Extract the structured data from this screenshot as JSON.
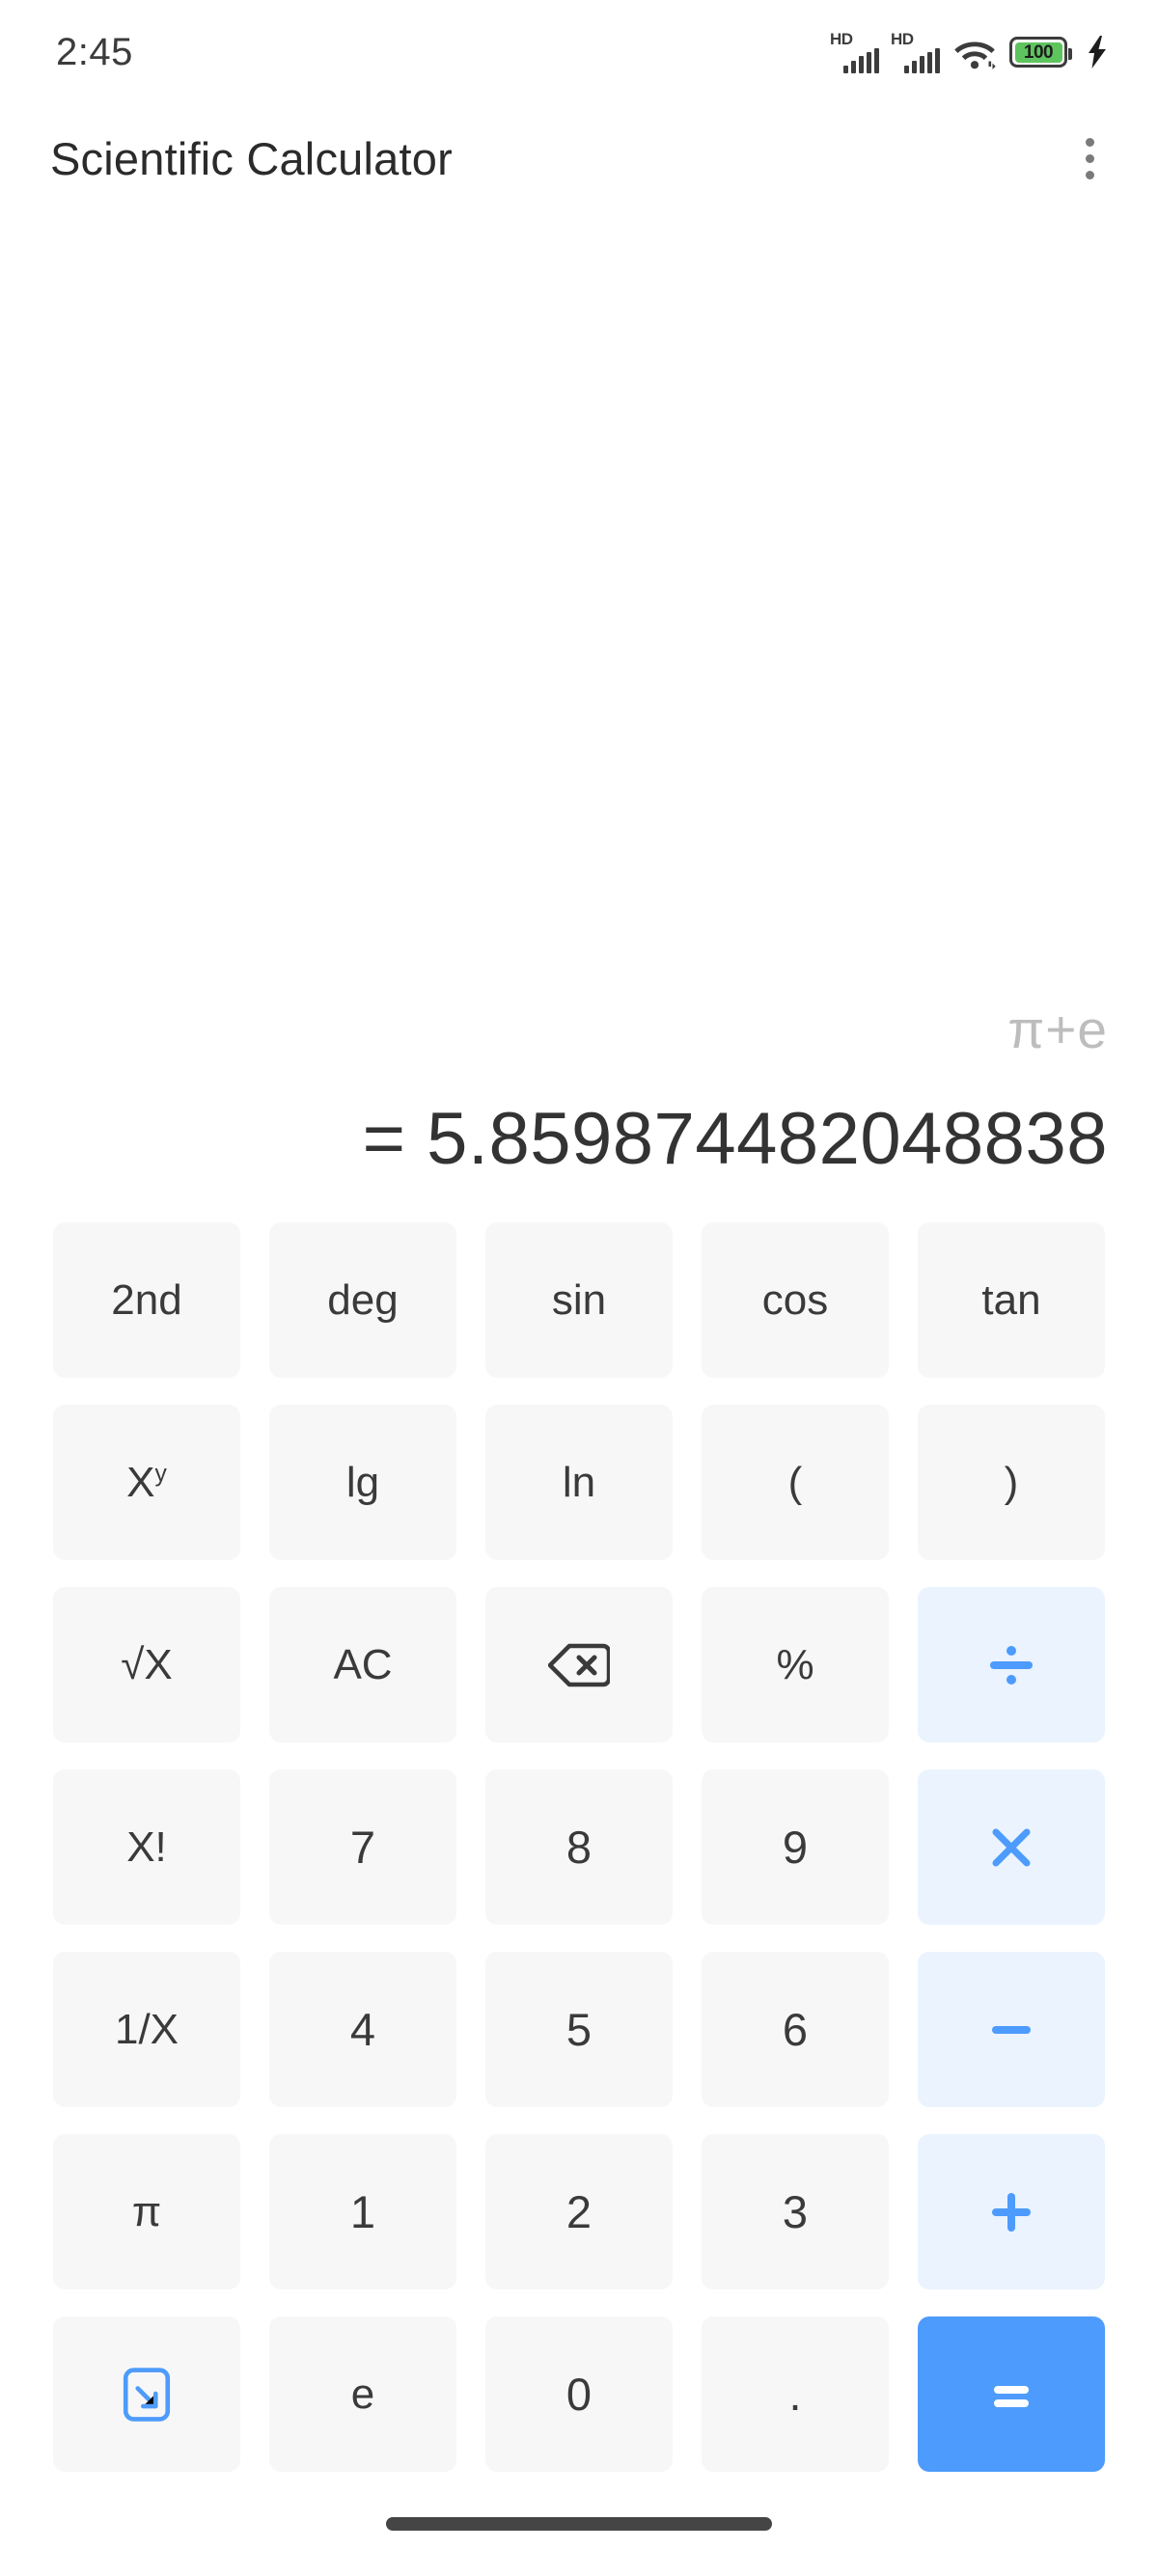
{
  "status_bar": {
    "time": "2:45",
    "signal_1_label": "HD",
    "signal_2_label": "HD",
    "wifi_icon": "wifi-icon",
    "battery_percent": "100",
    "charging_icon": "lightning-bolt-icon",
    "battery_color": "#5ec45e"
  },
  "app_bar": {
    "title": "Scientific Calculator",
    "overflow_icon": "more-vertical-icon"
  },
  "display": {
    "expression": "π+e",
    "result": "= 5.859874482048838",
    "expression_color": "#bdbdbd",
    "result_color": "#333333"
  },
  "theme": {
    "key_background": "#f7f7f8",
    "operator_background": "#eaf3fe",
    "operator_accent": "#4d9bfc",
    "equals_background": "#4d9bfc",
    "equals_text": "#ffffff",
    "key_text": "#3a3a3a"
  },
  "keypad": {
    "rows": [
      [
        {
          "label": "2nd",
          "name": "key-second",
          "type": "fn"
        },
        {
          "label": "deg",
          "name": "key-deg",
          "type": "fn"
        },
        {
          "label": "sin",
          "name": "key-sin",
          "type": "fn"
        },
        {
          "label": "cos",
          "name": "key-cos",
          "type": "fn"
        },
        {
          "label": "tan",
          "name": "key-tan",
          "type": "fn"
        }
      ],
      [
        {
          "label": "X",
          "sup": "y",
          "name": "key-power",
          "type": "fn"
        },
        {
          "label": "lg",
          "name": "key-log10",
          "type": "fn"
        },
        {
          "label": "ln",
          "name": "key-ln",
          "type": "fn"
        },
        {
          "label": "(",
          "name": "key-open-paren",
          "type": "fn"
        },
        {
          "label": ")",
          "name": "key-close-paren",
          "type": "fn"
        }
      ],
      [
        {
          "label": "√X",
          "name": "key-sqrt",
          "type": "fn"
        },
        {
          "label": "AC",
          "name": "key-all-clear",
          "type": "fn"
        },
        {
          "label": "",
          "icon": "backspace-icon",
          "name": "key-backspace",
          "type": "icon"
        },
        {
          "label": "%",
          "name": "key-percent",
          "type": "fn"
        },
        {
          "label": "÷",
          "icon": "divide-icon",
          "name": "key-divide",
          "type": "op"
        }
      ],
      [
        {
          "label": "X!",
          "name": "key-factorial",
          "type": "fn"
        },
        {
          "label": "7",
          "name": "key-7",
          "type": "digit"
        },
        {
          "label": "8",
          "name": "key-8",
          "type": "digit"
        },
        {
          "label": "9",
          "name": "key-9",
          "type": "digit"
        },
        {
          "label": "×",
          "icon": "multiply-icon",
          "name": "key-multiply",
          "type": "op"
        }
      ],
      [
        {
          "label": "1/X",
          "name": "key-reciprocal",
          "type": "fn"
        },
        {
          "label": "4",
          "name": "key-4",
          "type": "digit"
        },
        {
          "label": "5",
          "name": "key-5",
          "type": "digit"
        },
        {
          "label": "6",
          "name": "key-6",
          "type": "digit"
        },
        {
          "label": "−",
          "icon": "minus-icon",
          "name": "key-subtract",
          "type": "op"
        }
      ],
      [
        {
          "label": "π",
          "name": "key-pi",
          "type": "fn"
        },
        {
          "label": "1",
          "name": "key-1",
          "type": "digit"
        },
        {
          "label": "2",
          "name": "key-2",
          "type": "digit"
        },
        {
          "label": "3",
          "name": "key-3",
          "type": "digit"
        },
        {
          "label": "+",
          "icon": "plus-icon",
          "name": "key-add",
          "type": "op"
        }
      ],
      [
        {
          "label": "",
          "icon": "collapse-keypad-icon",
          "name": "key-collapse-keypad",
          "type": "icon"
        },
        {
          "label": "e",
          "name": "key-euler",
          "type": "fn"
        },
        {
          "label": "0",
          "name": "key-0",
          "type": "digit"
        },
        {
          "label": ".",
          "name": "key-decimal",
          "type": "digit"
        },
        {
          "label": "=",
          "icon": "equals-icon",
          "name": "key-equals",
          "type": "equals"
        }
      ]
    ]
  },
  "nav_bar": {
    "home_indicator": "home-gesture-pill"
  }
}
